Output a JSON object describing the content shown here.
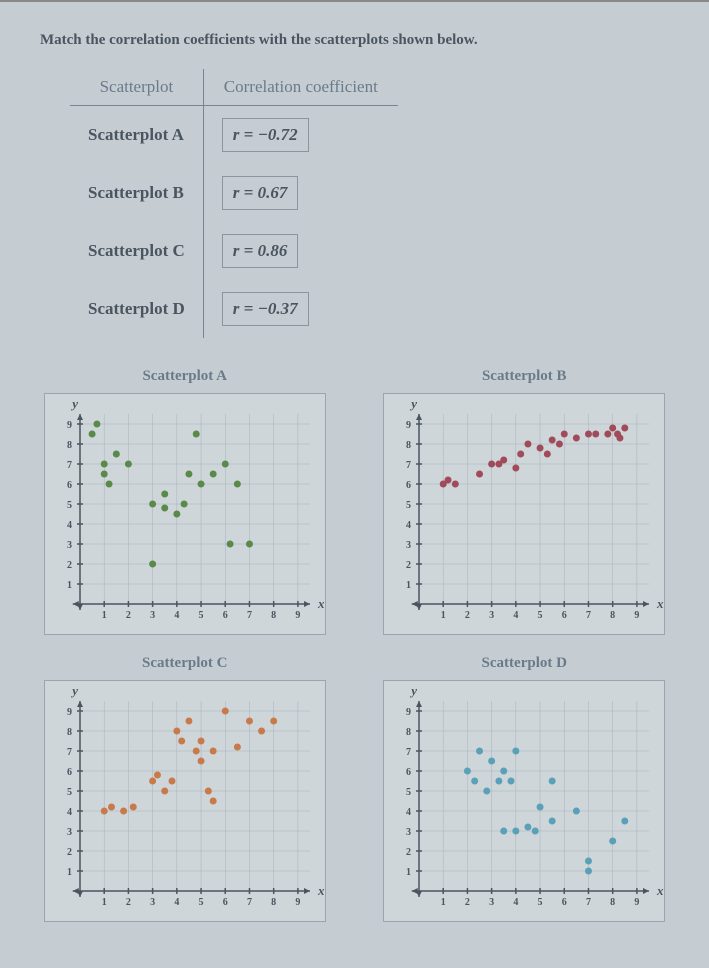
{
  "prompt": "Match the correlation coefficients with the scatterplots shown below.",
  "table": {
    "headers": [
      "Scatterplot",
      "Correlation coefficient"
    ],
    "rows": [
      {
        "label": "Scatterplot A",
        "coef": "r = −0.72"
      },
      {
        "label": "Scatterplot B",
        "coef": "r = 0.67"
      },
      {
        "label": "Scatterplot C",
        "coef": "r = 0.86"
      },
      {
        "label": "Scatterplot D",
        "coef": "r = −0.37"
      }
    ]
  },
  "axis": {
    "x_label": "x",
    "y_label": "y",
    "ticks": [
      1,
      2,
      3,
      4,
      5,
      6,
      7,
      8,
      9
    ]
  },
  "chart_data": [
    {
      "title": "Scatterplot A",
      "type": "scatter",
      "color": "#5a8a4a",
      "xlim": [
        0,
        9.5
      ],
      "ylim": [
        0,
        9.5
      ],
      "points": [
        [
          0.5,
          8.5
        ],
        [
          0.7,
          9.0
        ],
        [
          1.0,
          7.0
        ],
        [
          1.0,
          6.5
        ],
        [
          1.2,
          6.0
        ],
        [
          1.5,
          7.5
        ],
        [
          2.0,
          7.0
        ],
        [
          3.0,
          5.0
        ],
        [
          3.5,
          4.8
        ],
        [
          3.5,
          5.5
        ],
        [
          4.0,
          4.5
        ],
        [
          4.3,
          5.0
        ],
        [
          4.5,
          6.5
        ],
        [
          3.0,
          2.0
        ],
        [
          4.8,
          8.5
        ],
        [
          5.0,
          6.0
        ],
        [
          5.5,
          6.5
        ],
        [
          6.0,
          7.0
        ],
        [
          6.5,
          6.0
        ],
        [
          7.0,
          3.0
        ],
        [
          6.2,
          3.0
        ]
      ]
    },
    {
      "title": "Scatterplot B",
      "type": "scatter",
      "color": "#a04a5a",
      "xlim": [
        0,
        9.5
      ],
      "ylim": [
        0,
        9.5
      ],
      "points": [
        [
          1.0,
          6.0
        ],
        [
          1.2,
          6.2
        ],
        [
          1.5,
          6.0
        ],
        [
          2.5,
          6.5
        ],
        [
          3.0,
          7.0
        ],
        [
          3.3,
          7.0
        ],
        [
          3.5,
          7.2
        ],
        [
          4.0,
          6.8
        ],
        [
          4.2,
          7.5
        ],
        [
          4.5,
          8.0
        ],
        [
          5.0,
          7.8
        ],
        [
          5.3,
          7.5
        ],
        [
          5.5,
          8.2
        ],
        [
          5.8,
          8.0
        ],
        [
          6.0,
          8.5
        ],
        [
          6.5,
          8.3
        ],
        [
          7.0,
          8.5
        ],
        [
          7.3,
          8.5
        ],
        [
          7.8,
          8.5
        ],
        [
          8.0,
          8.8
        ],
        [
          8.2,
          8.5
        ],
        [
          8.3,
          8.3
        ],
        [
          8.5,
          8.8
        ]
      ]
    },
    {
      "title": "Scatterplot C",
      "type": "scatter",
      "color": "#c87a4a",
      "xlim": [
        0,
        9.5
      ],
      "ylim": [
        0,
        9.5
      ],
      "points": [
        [
          1.0,
          4.0
        ],
        [
          1.3,
          4.2
        ],
        [
          1.8,
          4.0
        ],
        [
          2.2,
          4.2
        ],
        [
          3.0,
          5.5
        ],
        [
          3.2,
          5.8
        ],
        [
          3.5,
          5.0
        ],
        [
          3.8,
          5.5
        ],
        [
          4.0,
          8.0
        ],
        [
          4.2,
          7.5
        ],
        [
          4.5,
          8.5
        ],
        [
          4.8,
          7.0
        ],
        [
          5.0,
          7.5
        ],
        [
          5.0,
          6.5
        ],
        [
          5.3,
          5.0
        ],
        [
          5.5,
          4.5
        ],
        [
          5.5,
          7.0
        ],
        [
          6.0,
          9.0
        ],
        [
          6.5,
          7.2
        ],
        [
          7.0,
          8.5
        ],
        [
          7.5,
          8.0
        ],
        [
          8.0,
          8.5
        ]
      ]
    },
    {
      "title": "Scatterplot D",
      "type": "scatter",
      "color": "#5aa0b8",
      "xlim": [
        0,
        9.5
      ],
      "ylim": [
        0,
        9.5
      ],
      "points": [
        [
          2.0,
          6.0
        ],
        [
          2.3,
          5.5
        ],
        [
          2.5,
          7.0
        ],
        [
          2.8,
          5.0
        ],
        [
          3.0,
          6.5
        ],
        [
          3.3,
          5.5
        ],
        [
          3.5,
          6.0
        ],
        [
          3.8,
          5.5
        ],
        [
          4.0,
          7.0
        ],
        [
          3.5,
          3.0
        ],
        [
          4.0,
          3.0
        ],
        [
          4.5,
          3.2
        ],
        [
          4.8,
          3.0
        ],
        [
          5.0,
          4.2
        ],
        [
          5.5,
          5.5
        ],
        [
          5.5,
          3.5
        ],
        [
          6.5,
          4.0
        ],
        [
          7.0,
          1.5
        ],
        [
          7.0,
          1.0
        ],
        [
          8.0,
          2.5
        ],
        [
          8.5,
          3.5
        ]
      ]
    }
  ]
}
